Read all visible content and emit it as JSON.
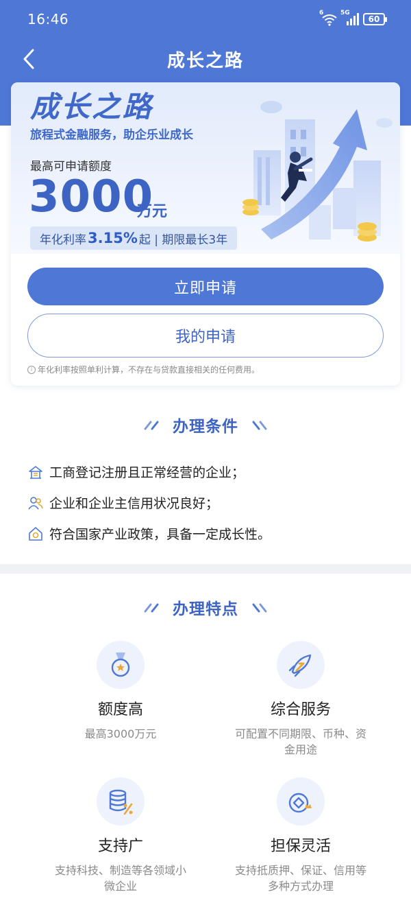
{
  "status_bar": {
    "time": "16:46",
    "network_label": "5G",
    "wifi_label": "6",
    "battery": "60"
  },
  "nav": {
    "title": "成长之路"
  },
  "hero": {
    "title": "成长之路",
    "subtitle": "旅程式金融服务，助企乐业成长",
    "limit_label": "最高可申请额度",
    "limit_value": "3000",
    "limit_unit": "万元",
    "rate_prefix": "年化利率",
    "rate_value": "3.15%",
    "rate_suffix": "起 | 期限最长3年"
  },
  "actions": {
    "apply_label": "立即申请",
    "my_apply_label": "我的申请"
  },
  "disclaimer": "年化利率按照单利计算，不存在与贷款直接相关的任何费用。",
  "conditions": {
    "title": "办理条件",
    "items": [
      {
        "text": "工商登记注册且正常经营的企业；",
        "icon": "building-icon"
      },
      {
        "text": "企业和企业主信用状况良好；",
        "icon": "people-icon"
      },
      {
        "text": "符合国家产业政策，具备一定成长性。",
        "icon": "growth-icon"
      }
    ]
  },
  "features": {
    "title": "办理特点",
    "items": [
      {
        "title": "额度高",
        "desc": "最高3000万元",
        "icon": "medal-icon"
      },
      {
        "title": "综合服务",
        "desc": "可配置不同期限、币种、资金用途",
        "icon": "rocket-icon"
      },
      {
        "title": "支持广",
        "desc": "支持科技、制造等各领域小微企业",
        "icon": "database-percent-icon"
      },
      {
        "title": "担保灵活",
        "desc": "支持抵质押、保证、信用等多种方式办理",
        "icon": "coin-crown-icon"
      }
    ]
  },
  "colors": {
    "primary": "#4e77d6",
    "accent_text": "#3e64c3",
    "background": "#ffffff",
    "separator": "#f0f1f4"
  }
}
